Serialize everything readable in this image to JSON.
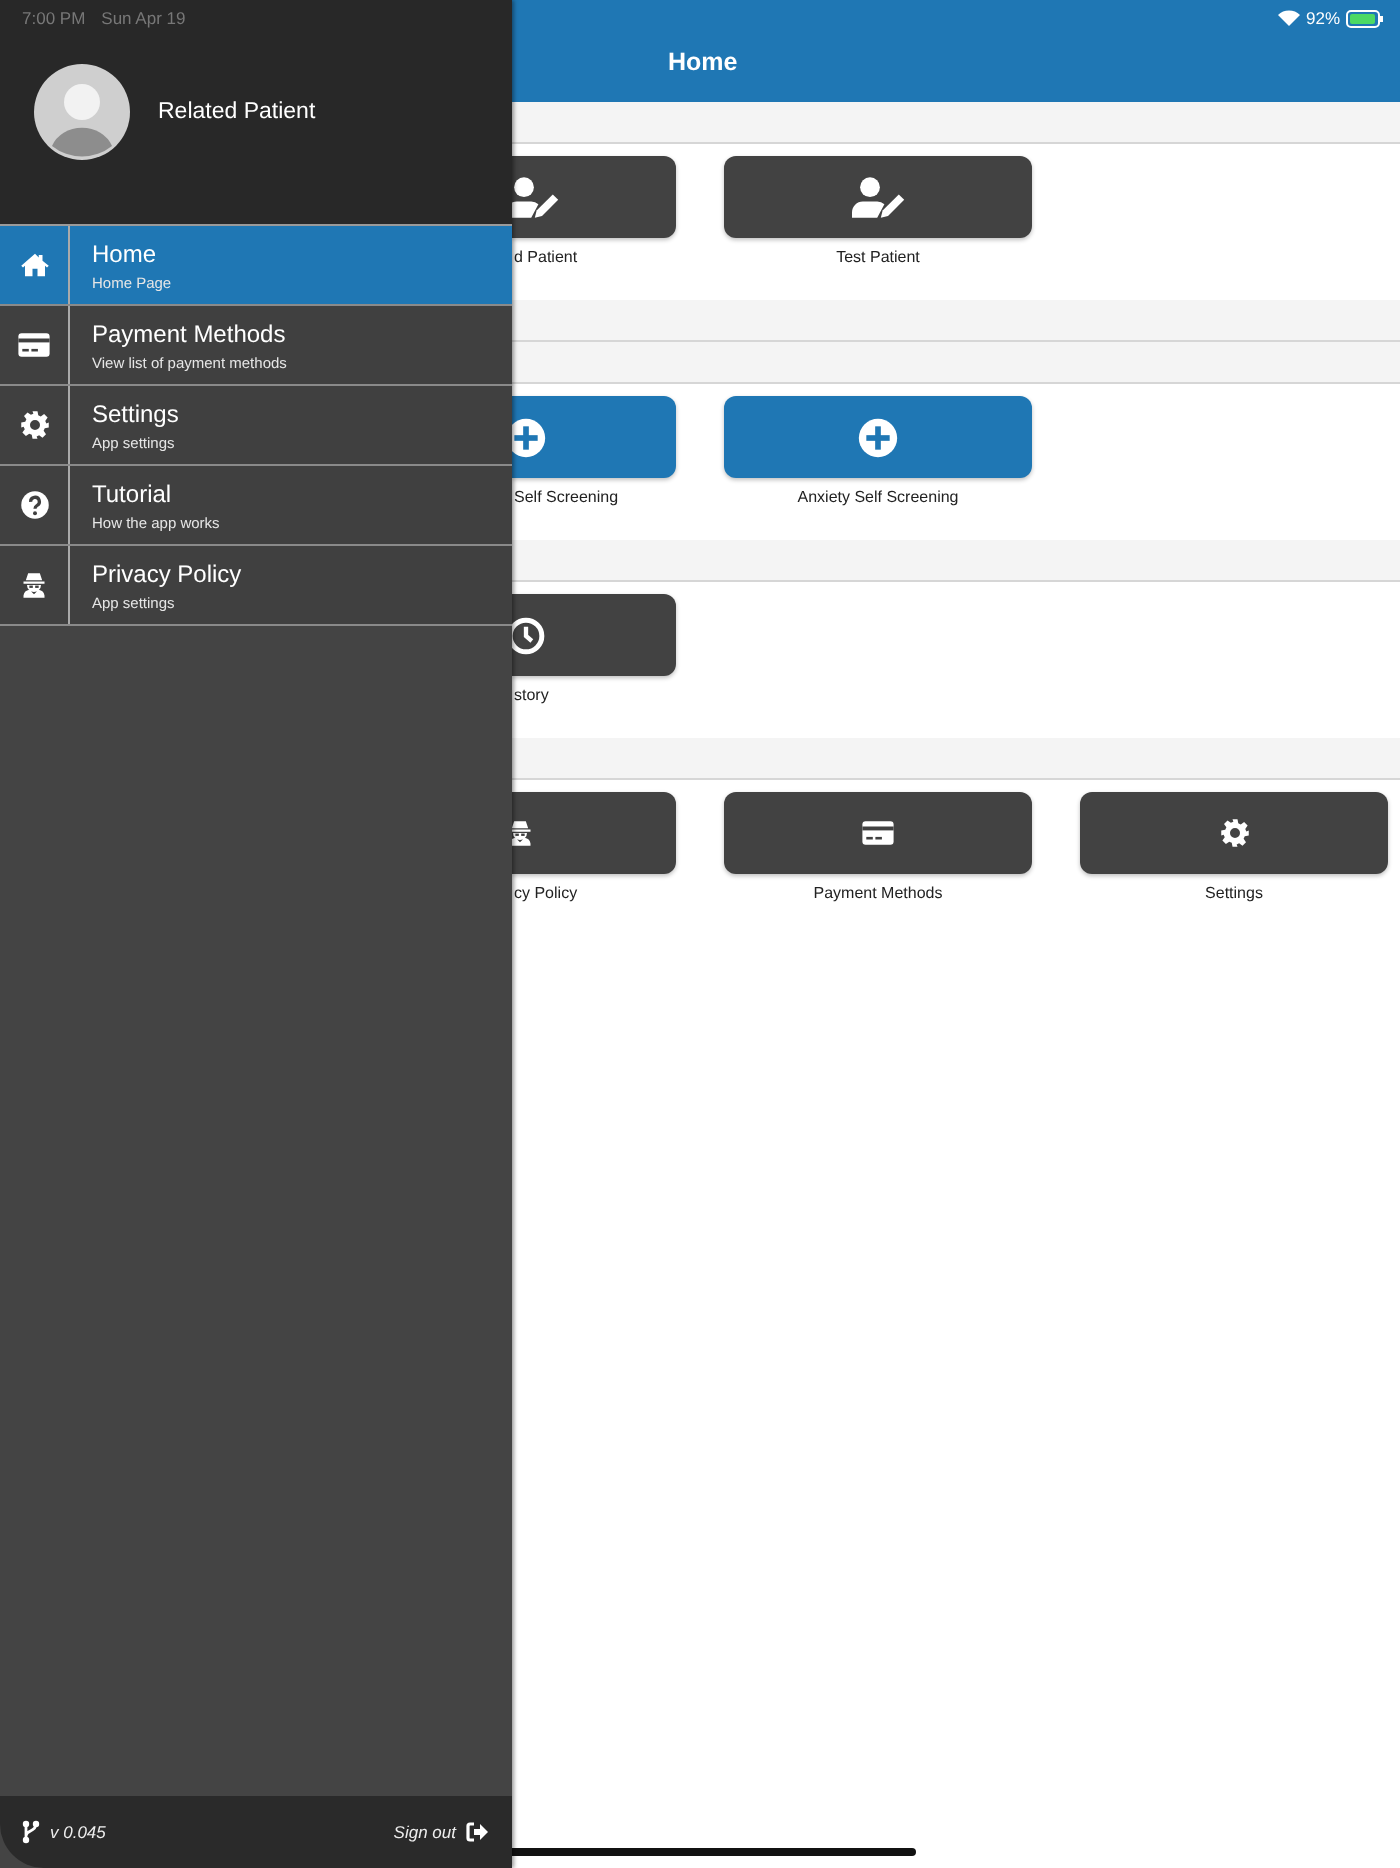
{
  "status_bar": {
    "time": "7:00 PM",
    "date": "Sun Apr 19",
    "battery": "92%"
  },
  "drawer": {
    "profile": {
      "name": "Related Patient"
    },
    "items": [
      {
        "kind": "home",
        "label": "Home",
        "subtitle": "Home Page",
        "selected": true
      },
      {
        "kind": "payment",
        "label": "Payment Methods",
        "subtitle": "View list of payment methods",
        "selected": false
      },
      {
        "kind": "settings",
        "label": "Settings",
        "subtitle": "App settings",
        "selected": false
      },
      {
        "kind": "tutorial",
        "label": "Tutorial",
        "subtitle": "How the app works",
        "selected": false
      },
      {
        "kind": "privacy",
        "label": "Privacy Policy",
        "subtitle": "App settings",
        "selected": false
      }
    ],
    "footer": {
      "version": "v 0.045",
      "sign_out": "Sign out"
    }
  },
  "header": {
    "title": "Home"
  },
  "sections": [
    {
      "kind": "tiles",
      "tiles": [
        {
          "kind": "patient",
          "label": "d Patient"
        },
        {
          "kind": "patient",
          "label": "Test Patient"
        }
      ]
    },
    {
      "kind": "empty"
    },
    {
      "kind": "tiles",
      "tiles": [
        {
          "kind": "screening",
          "label": "Self Screening"
        },
        {
          "kind": "screening",
          "label": "Anxiety Self Screening"
        }
      ]
    },
    {
      "kind": "tiles",
      "tiles": [
        {
          "kind": "history",
          "label": "story"
        }
      ]
    },
    {
      "kind": "tiles",
      "tiles": [
        {
          "kind": "privacy",
          "label": "cy Policy"
        },
        {
          "kind": "payment",
          "label": "Payment Methods"
        },
        {
          "kind": "settings",
          "label": "Settings"
        }
      ]
    }
  ]
}
